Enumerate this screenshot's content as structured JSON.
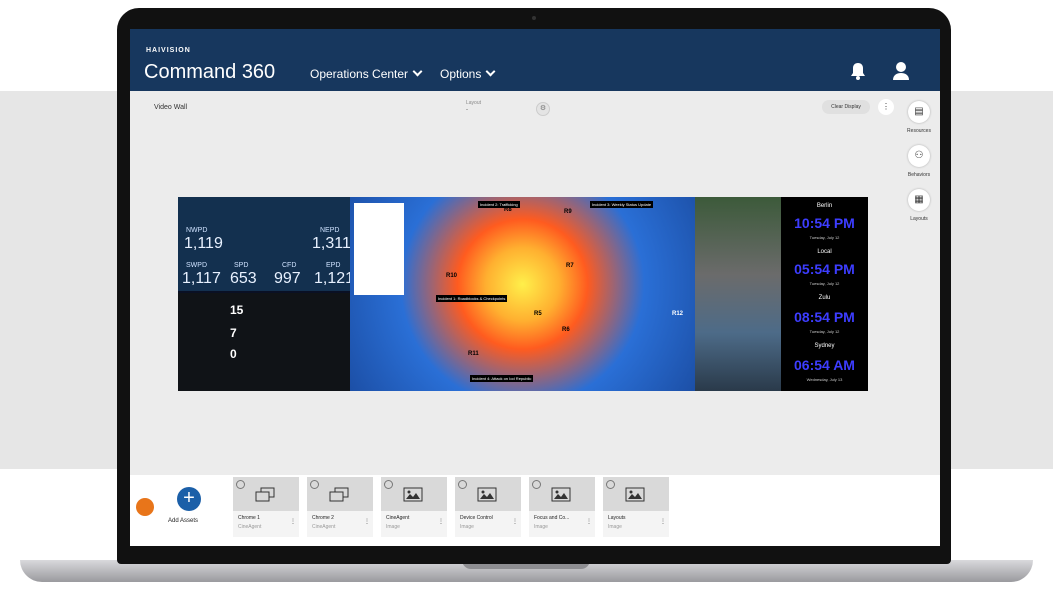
{
  "brand": {
    "company": "HAIVISION",
    "product": "Command 360"
  },
  "nav": {
    "items": [
      {
        "label": "Operations Center"
      },
      {
        "label": "Options"
      }
    ]
  },
  "page": {
    "title": "Video Wall",
    "layout_label": "Layout",
    "layout_value": "-"
  },
  "toolbar": {
    "clear_display": "Clear Display",
    "more": "⋮"
  },
  "side": {
    "items": [
      {
        "label": "Resources",
        "icon": "resources-icon"
      },
      {
        "label": "Behaviors",
        "icon": "behaviors-icon"
      },
      {
        "label": "Layouts",
        "icon": "layouts-icon"
      }
    ]
  },
  "wall": {
    "stats": [
      {
        "label": "NWPD",
        "value": "1,119"
      },
      {
        "label": "NEPD",
        "value": "1,311"
      },
      {
        "label": "SWPD",
        "value": "1,117"
      },
      {
        "label": "SPD",
        "value": "653"
      },
      {
        "label": "CFD",
        "value": "997"
      },
      {
        "label": "EPD",
        "value": "1,121"
      }
    ],
    "panel_numbers": [
      "15",
      "7",
      "0"
    ],
    "regions": [
      "R8",
      "R9",
      "R7",
      "R10",
      "R11",
      "R5",
      "R6",
      "R12"
    ],
    "incidents": [
      "Incident 2: Trafficking",
      "Incident 3: Weekly Status Update",
      "Incident 1: Roadblocks & Checkpoints",
      "Incident 4: Attack on Iod Republic"
    ],
    "clocks": [
      {
        "city": "Berlin",
        "time": "10:54 PM",
        "date": "Tuesday, July 12"
      },
      {
        "city": "Local",
        "time": "05:54 PM",
        "date": "Tuesday, July 12"
      },
      {
        "city": "Zulu",
        "time": "08:54 PM",
        "date": "Tuesday, July 12"
      },
      {
        "city": "Sydney",
        "time": "06:54 AM",
        "date": "Wednesday, July 13"
      }
    ]
  },
  "assets": {
    "add_label": "Add Assets",
    "cards": [
      {
        "title": "Chrome 1",
        "sub": "CineAgent",
        "icon": "stack-icon"
      },
      {
        "title": "Chrome 2",
        "sub": "CineAgent",
        "icon": "stack-icon"
      },
      {
        "title": "CineAgent",
        "sub": "Image",
        "icon": "image-icon"
      },
      {
        "title": "Device Control",
        "sub": "Image",
        "icon": "image-icon"
      },
      {
        "title": "Focus and Co...",
        "sub": "Image",
        "icon": "image-icon"
      },
      {
        "title": "Layouts",
        "sub": "Image",
        "icon": "image-icon"
      }
    ]
  },
  "colors": {
    "header": "#17375e",
    "accent": "#1b5fa8",
    "orange": "#e8751a",
    "clock": "#3d3dff"
  }
}
